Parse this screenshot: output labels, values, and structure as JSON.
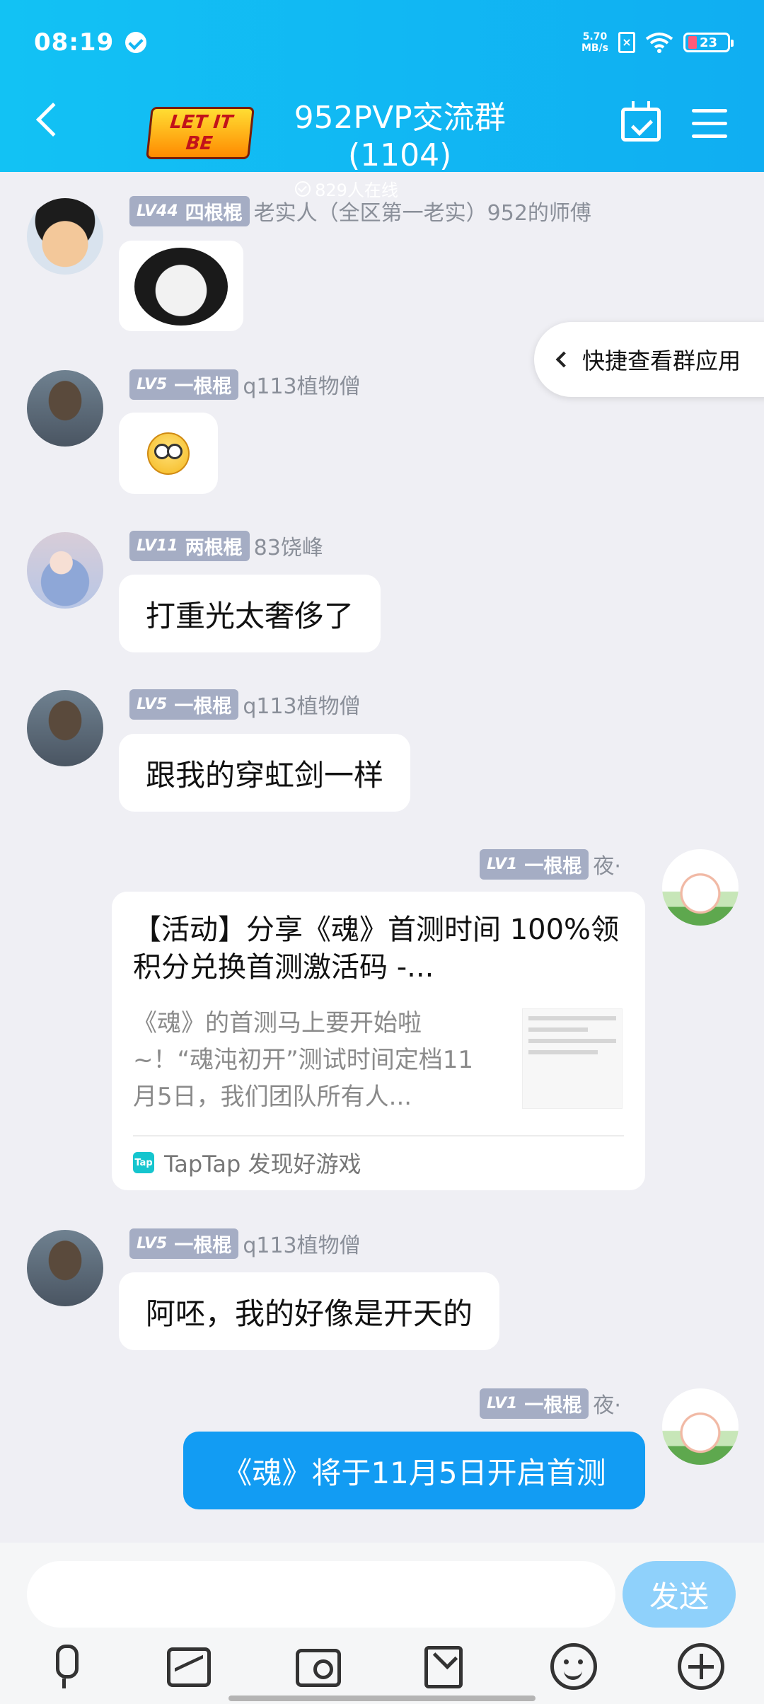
{
  "status_bar": {
    "time": "08:19",
    "net_speed": "5.70",
    "net_unit": "MB/s",
    "battery": "23"
  },
  "header": {
    "logo_text": "LET IT BE",
    "title": "952PVP交流群(1104)",
    "online": "829人在线"
  },
  "quick_panel": {
    "label": "快捷查看群应用"
  },
  "messages": [
    {
      "level": "LV44",
      "rank": "四根棍",
      "name": "老实人（全区第一老实）952的师傅",
      "type": "sticker"
    },
    {
      "level": "LV5",
      "rank": "一根棍",
      "name": "q113植物僧",
      "type": "emoji"
    },
    {
      "level": "LV11",
      "rank": "两根棍",
      "name": "83饶峰",
      "text": "打重光太奢侈了"
    },
    {
      "level": "LV5",
      "rank": "一根棍",
      "name": "q113植物僧",
      "text": "跟我的穿虹剑一样"
    },
    {
      "level": "LV1",
      "rank": "一根棍",
      "name": "夜·",
      "type": "card",
      "card": {
        "title": "【活动】分享《魂》首测时间 100%领积分兑换首测激活码 -...",
        "desc": "《魂》的首测马上要开始啦~！“魂沌初开”测试时间定档11月5日，我们团队所有人...",
        "source_icon": "Tap",
        "source": "TapTap 发现好游戏"
      }
    },
    {
      "level": "LV5",
      "rank": "一根棍",
      "name": "q113植物僧",
      "text": "阿呸，我的好像是开天的"
    },
    {
      "level": "LV1",
      "rank": "一根棍",
      "name": "夜·",
      "text": "《魂》将于11月5日开启首测"
    }
  ],
  "composer": {
    "send_label": "发送",
    "placeholder": ""
  },
  "colors": {
    "header": "#12c2f4",
    "own_bubble": "#129cf3",
    "send_button": "#8fd1fb"
  }
}
